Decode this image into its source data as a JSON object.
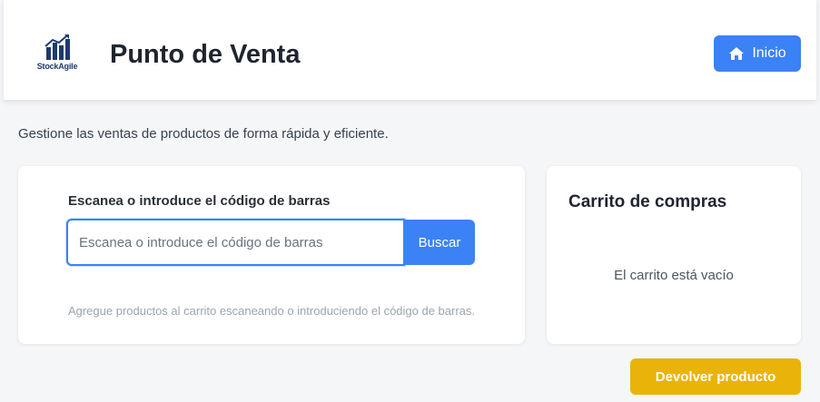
{
  "header": {
    "logo_text": "StockAgile",
    "title": "Punto de Venta",
    "home_button": {
      "label": "Inicio",
      "icon": "home-icon"
    }
  },
  "subtitle": "Gestione las ventas de productos de forma rápida y eficiente.",
  "scanner": {
    "label": "Escanea o introduce el código de barras",
    "input_value": "",
    "input_placeholder": "Escanea o introduce el código de barras",
    "search_button": "Buscar",
    "hint": "Agregue productos al carrito escaneando o introduciendo el código de barras."
  },
  "cart": {
    "title": "Carrito de compras",
    "empty_message": "El carrito está vacío"
  },
  "return_button": "Devolver producto",
  "colors": {
    "primary": "#3b82f6",
    "warning": "#eab308",
    "background": "#f5f6f8",
    "logo": "#1e3a6e"
  }
}
